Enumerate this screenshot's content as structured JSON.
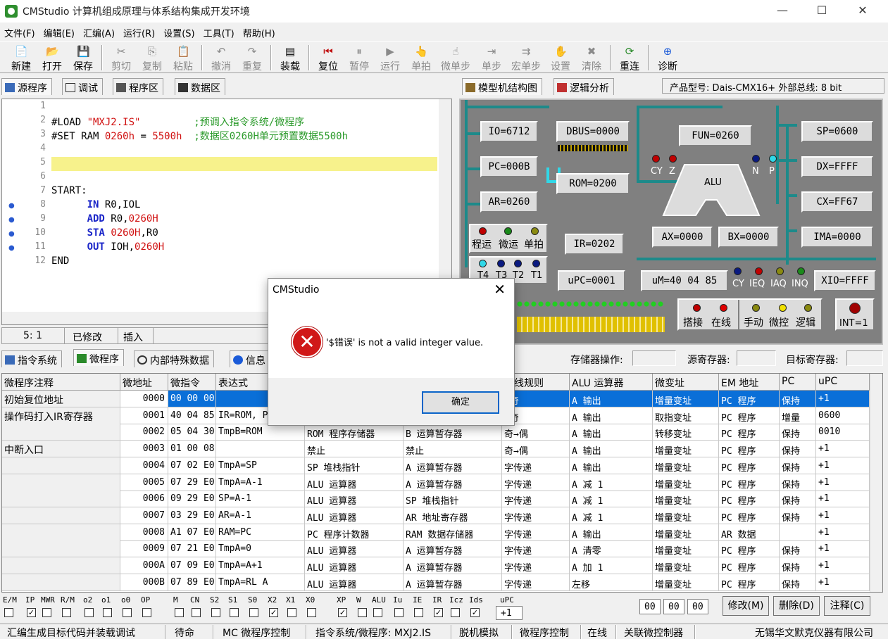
{
  "window": {
    "title": "CMStudio 计算机组成原理与体系结构集成开发环境",
    "minimize": "—",
    "maximize": "☐",
    "close": "✕"
  },
  "menu": [
    "文件(F)",
    "编辑(E)",
    "汇编(A)",
    "运行(R)",
    "设置(S)",
    "工具(T)",
    "帮助(H)"
  ],
  "toolbar": [
    {
      "label": "新建",
      "icon": "📄",
      "enabled": true
    },
    {
      "label": "打开",
      "icon": "📂",
      "enabled": true
    },
    {
      "label": "保存",
      "icon": "💾",
      "enabled": true
    },
    {
      "label": "剪切",
      "icon": "✂",
      "enabled": false
    },
    {
      "label": "复制",
      "icon": "⎘",
      "enabled": false
    },
    {
      "label": "粘贴",
      "icon": "📋",
      "enabled": false
    },
    {
      "label": "撤消",
      "icon": "↶",
      "enabled": false
    },
    {
      "label": "重复",
      "icon": "↷",
      "enabled": false
    },
    {
      "label": "装载",
      "icon": "▤",
      "enabled": true
    },
    {
      "label": "复位",
      "icon": "⏮",
      "enabled": true
    },
    {
      "label": "暂停",
      "icon": "⏸",
      "enabled": false
    },
    {
      "label": "运行",
      "icon": "▶",
      "enabled": false
    },
    {
      "label": "单拍",
      "icon": "👆",
      "enabled": false
    },
    {
      "label": "微单步",
      "icon": "☝",
      "enabled": false
    },
    {
      "label": "单步",
      "icon": "⇥",
      "enabled": false
    },
    {
      "label": "宏单步",
      "icon": "⇉",
      "enabled": false
    },
    {
      "label": "设置",
      "icon": "✋",
      "enabled": false
    },
    {
      "label": "清除",
      "icon": "✖",
      "enabled": false
    },
    {
      "label": "重连",
      "icon": "⟳",
      "enabled": true
    },
    {
      "label": "诊断",
      "icon": "⊕",
      "enabled": true
    }
  ],
  "left_tabs": [
    "源程序",
    "调试",
    "程序区",
    "数据区"
  ],
  "right_tabs": [
    "模型机结构图",
    "逻辑分析"
  ],
  "product_label": "产品型号: Dais-CMX16+ 外部总线: 8 bit",
  "editor": {
    "lines": [
      {
        "n": "1",
        "code": ""
      },
      {
        "n": "2",
        "code": "#LOAD \"MXJ2.IS\"         ;预调入指令系统/微程序"
      },
      {
        "n": "3",
        "code": "#SET RAM 0260h = 5500h  ;数据区0260H单元预置数据5500h"
      },
      {
        "n": "4",
        "code": ""
      },
      {
        "n": "5",
        "code": ""
      },
      {
        "n": "6",
        "code": ""
      },
      {
        "n": "7",
        "code": "START:"
      },
      {
        "n": "8",
        "code": "      IN R0,IOL"
      },
      {
        "n": "9",
        "code": "      ADD R0,0260H"
      },
      {
        "n": "10",
        "code": "      STA 0260H,R0"
      },
      {
        "n": "11",
        "code": "      OUT IOH,0260H"
      },
      {
        "n": "12",
        "code": "END"
      }
    ],
    "breakpoint_lines": [
      "8",
      "9",
      "10",
      "11"
    ],
    "status": {
      "pos": "5:  1",
      "modified": "已修改",
      "mode": "插入"
    }
  },
  "model": {
    "registers": {
      "io": "IO=6712",
      "dbus": "DBUS=0000",
      "fun": "FUN=0260",
      "sp": "SP=0600",
      "pc": "PC=000B",
      "rom": "ROM=0200",
      "dx": "DX=FFFF",
      "ar": "AR=0260",
      "cx": "CX=FF67",
      "ir": "IR=0202",
      "ax": "AX=0000",
      "bx": "BX=0000",
      "ima": "IMA=0000",
      "upc": "uPC=0001",
      "um": "uM=40 04 85",
      "xio": "XIO=FFFF",
      "int": "INT=1"
    },
    "alu_label": "ALU",
    "flags_left": [
      "CY",
      "Z"
    ],
    "flags_right": [
      "N",
      "P"
    ],
    "mode_leds": [
      "程运",
      "微运",
      "单拍"
    ],
    "timing_leds": [
      "T4",
      "T3",
      "T2",
      "T1"
    ],
    "status_leds": [
      "CY",
      "IEQ",
      "IAQ",
      "INQ"
    ],
    "control_leds_1": [
      "搭接",
      "在线"
    ],
    "control_leds_2": [
      "手动",
      "微控",
      "逻辑"
    ],
    "colors": {
      "bus": "#1d8a8a",
      "panel_bg": "#808080",
      "led_red": "#c00000",
      "led_green": "#1a8a1a",
      "led_olive": "#8a8a10",
      "led_blue": "#0a1a80",
      "led_cyan": "#30d8e8",
      "led_yellow": "#f0e000"
    }
  },
  "lower_tabs": [
    "指令系统",
    "微程序",
    "内部特殊数据",
    "信息"
  ],
  "lower_labels": {
    "mem_op": "存储器操作:",
    "src": "源寄存器:",
    "dst": "目标寄存器:"
  },
  "table": {
    "headers": [
      "微程序注释",
      "微地址",
      "微指令",
      "表达式",
      "",
      "",
      "总线规则",
      "ALU 运算器",
      "微变址",
      "EM 地址",
      "PC",
      "uPC"
    ],
    "rows": [
      [
        "初始复位地址",
        "0000",
        "00 00 00",
        "",
        "",
        "",
        "→奇",
        "A 输出",
        "增量变址",
        "PC 程序",
        "保持",
        "+1"
      ],
      [
        "操作码打入IR寄存器",
        "0001",
        "40 04 85",
        "IR=ROM, PC",
        "",
        "",
        "→奇",
        "A 输出",
        "取指变址",
        "PC 程序",
        "增量",
        "0600"
      ],
      [
        "",
        "0002",
        "05 04 30",
        "TmpB=ROM",
        "ROM 程序存储器",
        "B 运算暂存器",
        "奇→偶",
        "A 输出",
        "转移变址",
        "PC 程序",
        "保持",
        "0010"
      ],
      [
        "中断入口",
        "0003",
        "01 00 08",
        "",
        "禁止",
        "禁止",
        "奇→偶",
        "A 输出",
        "增量变址",
        "PC 程序",
        "保持",
        "+1"
      ],
      [
        "",
        "0004",
        "07 02 E0",
        "TmpA=SP",
        "SP 堆栈指针",
        "A 运算暂存器",
        "字传递",
        "A 输出",
        "增量变址",
        "PC 程序",
        "保持",
        "+1"
      ],
      [
        "",
        "0005",
        "07 29 E0",
        "TmpA=A-1",
        "ALU 运算器",
        "A 运算暂存器",
        "字传递",
        "A 减 1",
        "增量变址",
        "PC 程序",
        "保持",
        "+1"
      ],
      [
        "",
        "0006",
        "09 29 E0",
        "SP=A-1",
        "ALU 运算器",
        "SP 堆栈指针",
        "字传递",
        "A 减 1",
        "增量变址",
        "PC 程序",
        "保持",
        "+1"
      ],
      [
        "",
        "0007",
        "03 29 E0",
        "AR=A-1",
        "ALU 运算器",
        "AR 地址寄存器",
        "字传递",
        "A 减 1",
        "增量变址",
        "PC 程序",
        "保持",
        "+1"
      ],
      [
        "",
        "0008",
        "A1 07 E0",
        "RAM=PC",
        "PC 程序计数器",
        "RAM 数据存储器",
        "字传递",
        "A 输出",
        "增量变址",
        "AR 数据",
        "",
        "+1"
      ],
      [
        "",
        "0009",
        "07 21 E0",
        "TmpA=0",
        "ALU 运算器",
        "A 运算暂存器",
        "字传递",
        "A 清零",
        "增量变址",
        "PC 程序",
        "保持",
        "+1"
      ],
      [
        "",
        "000A",
        "07 09 E0",
        "TmpA=A+1",
        "ALU 运算器",
        "A 运算暂存器",
        "字传递",
        "A 加 1",
        "增量变址",
        "PC 程序",
        "保持",
        "+1"
      ],
      [
        "",
        "000B",
        "07 89 E0",
        "TmpA=RL A",
        "ALU 运算器",
        "A 运算暂存器",
        "字传递",
        "左移",
        "增量变址",
        "PC 程序",
        "保持",
        "+1"
      ]
    ],
    "selected_row": 0
  },
  "bits": {
    "labels": [
      "E/M",
      "IP",
      "MWR",
      "R/M",
      "o2",
      "o1",
      "o0",
      "OP",
      "M",
      "CN",
      "S2",
      "S1",
      "S0",
      "X2",
      "X1",
      "X0",
      "XP",
      "W",
      "ALU",
      "Iu",
      "IE",
      "IR",
      "Icz",
      "Ids",
      "uPC"
    ],
    "checked": [
      false,
      true,
      false,
      false,
      false,
      false,
      false,
      false,
      false,
      false,
      false,
      false,
      false,
      true,
      false,
      false,
      true,
      false,
      false,
      false,
      false,
      true,
      false,
      true
    ],
    "upc_value": "+1",
    "hex_inputs": [
      "00",
      "00",
      "00"
    ]
  },
  "buttons": {
    "modify": "修改(M)",
    "delete": "删除(D)",
    "note": "注释(C)"
  },
  "statusbar": [
    "汇编生成目标代码并装载调试",
    "待命",
    "MC 微程序控制",
    "指令系统/微程序: MXJ2.IS",
    "脱机模拟",
    "微程序控制",
    "在线",
    "关联微控制器",
    "无锡华文默克仪器有限公司"
  ],
  "dialog": {
    "title": "CMStudio",
    "message": "'$错误' is not a valid integer value.",
    "ok": "确定",
    "close": "✕",
    "icon": "✕"
  }
}
